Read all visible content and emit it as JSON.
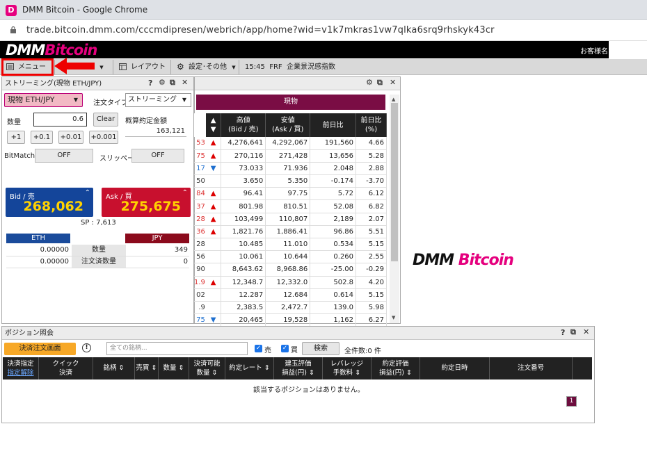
{
  "browser": {
    "title": "DMM Bitcoin - Google Chrome",
    "url": "trade.bitcoin.dmm.com/cccmdipresen/webrich/app/home?wid=v1k7mkras1vw7qlka6srq9rhskyk43cr",
    "icon_letter": "D"
  },
  "header": {
    "logo_dmm": "DMM",
    "logo_bitcoin": "Bitcoin",
    "customer": "お客様名"
  },
  "menubar": {
    "menu": "メニュー",
    "partial": "理",
    "layout": "レイアウト",
    "settings": "設定･その他",
    "news_time": "15:45",
    "news_code": "FRF",
    "news_title": "企業景況感指数"
  },
  "streaming": {
    "title": "ストリーミング(現物 ETH/JPY)",
    "symbol": "現物 ETH/JPY",
    "order_type_label": "注文タイプ",
    "order_type": "ストリーミング",
    "qty_label": "数量",
    "qty_value": "0.6",
    "clear": "Clear",
    "est_label": "概算約定金額",
    "est_value": "163,121",
    "steps": [
      "+1",
      "+0.1",
      "+0.01",
      "+0.001"
    ],
    "bitmatch_label": "BitMatch",
    "bitmatch_value": "OFF",
    "slippage_label": "スリッページ",
    "slippage_value": "OFF",
    "bid_label": "Bid / 売",
    "bid_value": "268,062",
    "ask_label": "Ask / 買",
    "ask_value": "275,675",
    "spread": "SP : 7,613",
    "eth": "ETH",
    "jpy": "JPY",
    "bal_rows": [
      {
        "left": "0.00000",
        "label": "数量",
        "right": "349"
      },
      {
        "left": "0.00000",
        "label": "注文済数量",
        "right": "0"
      }
    ]
  },
  "prices": {
    "tab": "現物",
    "headers": [
      "▲▼",
      "高値\n(Bid / 売)",
      "安値\n(Ask / 買)",
      "前日比",
      "前日比\n(%)"
    ],
    "rows": [
      {
        "cut": "53",
        "dir": "up",
        "high": "4,276,641",
        "low": "4,292,067",
        "chg": "191,560",
        "pct": "4.66"
      },
      {
        "cut": "75",
        "dir": "up",
        "high": "270,116",
        "low": "271,428",
        "chg": "13,656",
        "pct": "5.28"
      },
      {
        "cut": "17",
        "dir": "dn",
        "high": "73.033",
        "low": "71.936",
        "chg": "2.048",
        "pct": "2.88"
      },
      {
        "cut": "50",
        "dir": "",
        "high": "3.650",
        "low": "5.350",
        "chg": "-0.174",
        "pct": "-3.70"
      },
      {
        "cut": "84",
        "dir": "up",
        "high": "96.41",
        "low": "97.75",
        "chg": "5.72",
        "pct": "6.12"
      },
      {
        "cut": "37",
        "dir": "up",
        "high": "801.98",
        "low": "810.51",
        "chg": "52.08",
        "pct": "6.82"
      },
      {
        "cut": "28",
        "dir": "up",
        "high": "103,499",
        "low": "110,807",
        "chg": "2,189",
        "pct": "2.07"
      },
      {
        "cut": "36",
        "dir": "up",
        "high": "1,821.76",
        "low": "1,886.41",
        "chg": "96.86",
        "pct": "5.51"
      },
      {
        "cut": "28",
        "dir": "",
        "high": "10.485",
        "low": "11.010",
        "chg": "0.534",
        "pct": "5.15"
      },
      {
        "cut": "56",
        "dir": "",
        "high": "10.061",
        "low": "10.644",
        "chg": "0.260",
        "pct": "2.55"
      },
      {
        "cut": "90",
        "dir": "",
        "high": "8,643.62",
        "low": "8,968.86",
        "chg": "-25.00",
        "pct": "-0.29"
      },
      {
        "cut": "1.9",
        "dir": "up",
        "high": "12,348.7",
        "low": "12,332.0",
        "chg": "502.8",
        "pct": "4.20"
      },
      {
        "cut": "02",
        "dir": "",
        "high": "12.287",
        "low": "12.684",
        "chg": "0.614",
        "pct": "5.15"
      },
      {
        "cut": ".9",
        "dir": "",
        "high": "2,383.5",
        "low": "2,472.7",
        "chg": "139.0",
        "pct": "5.98"
      },
      {
        "cut": "75",
        "dir": "dn",
        "high": "20,465",
        "low": "19,528",
        "chg": "1,162",
        "pct": "6.27"
      }
    ]
  },
  "positions": {
    "title": "ポジション照会",
    "settle_btn": "決済注文画面",
    "search_placeholder": "全ての銘柄...",
    "sell": "売",
    "buy": "買",
    "search": "検索",
    "count": "全件数:0 件",
    "cols": [
      "決済指定\n指定解除",
      "クイック\n決済",
      "銘柄",
      "売買",
      "数量",
      "決済可能\n数量",
      "約定レート",
      "建玉評価\n損益(円)",
      "レバレッジ\n手数料",
      "約定評価\n損益(円)",
      "約定日時",
      "注文番号"
    ],
    "empty": "該当するポジションはありません。",
    "page": "1"
  },
  "colors": {
    "bid": "#14459a",
    "ask": "#c8102e",
    "brand": "#e5007e",
    "accent": "#7a0d44"
  }
}
